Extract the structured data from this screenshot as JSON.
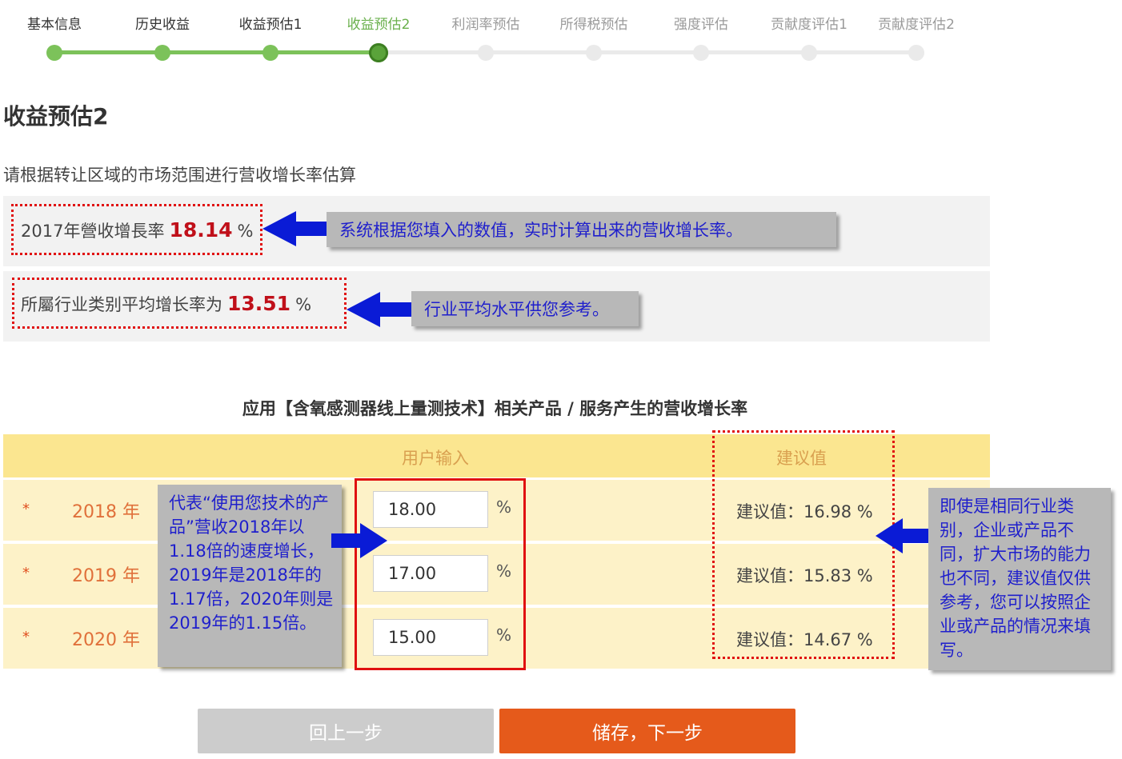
{
  "steps": [
    {
      "label": "基本信息",
      "state": "done"
    },
    {
      "label": "历史收益",
      "state": "done"
    },
    {
      "label": "收益预估1",
      "state": "done"
    },
    {
      "label": "收益预估2",
      "state": "active"
    },
    {
      "label": "利润率预估",
      "state": "todo"
    },
    {
      "label": "所得税预估",
      "state": "todo"
    },
    {
      "label": "强度评估",
      "state": "todo"
    },
    {
      "label": "贡献度评估1",
      "state": "todo"
    },
    {
      "label": "贡献度评估2",
      "state": "todo"
    }
  ],
  "page_title": "收益预估2",
  "instruction": "请根据转让区域的市场范围进行营收增长率估算",
  "growth_2017": {
    "prefix": "2017年營收增長率",
    "value": "18.14",
    "unit": "%"
  },
  "industry_avg": {
    "prefix": "所屬行业类别平均增长率为",
    "value": "13.51",
    "unit": "%"
  },
  "callouts": {
    "realtime": "系统根据您填入的数值，实时计算出来的营收增长率。",
    "industry": "行业平均水平供您参考。",
    "meaning": "代表“使用您技术的产品”营收2018年以1.18倍的速度增长，2019年是2018年的1.17倍，2020年则是2019年的1.15倍。",
    "suggest": "即使是相同行业类别，企业或产品不同，扩大市场的能力也不同，建议值仅供参考，您可以按照企业或产品的情况来填写。"
  },
  "table": {
    "title": "应用【含氧感测器线上量测技术】相关产品 / 服务产生的营收增长率",
    "col_user": "用户输入",
    "col_suggest": "建议值",
    "rows": [
      {
        "star": "*",
        "year": "2018 年",
        "input": "18.00",
        "unit": "%",
        "suggest": "建议值：16.98 %"
      },
      {
        "star": "*",
        "year": "2019 年",
        "input": "17.00",
        "unit": "%",
        "suggest": "建议值：15.83 %"
      },
      {
        "star": "*",
        "year": "2020 年",
        "input": "15.00",
        "unit": "%",
        "suggest": "建议值：14.67 %"
      }
    ]
  },
  "buttons": {
    "back": "回上一步",
    "next": "储存，下一步"
  },
  "colors": {
    "step_done": "#7cc25a",
    "step_active": "#5aa33a",
    "accent_red": "#c0101a",
    "next_button": "#e55a1b",
    "callout_text": "#1f1fcc"
  }
}
